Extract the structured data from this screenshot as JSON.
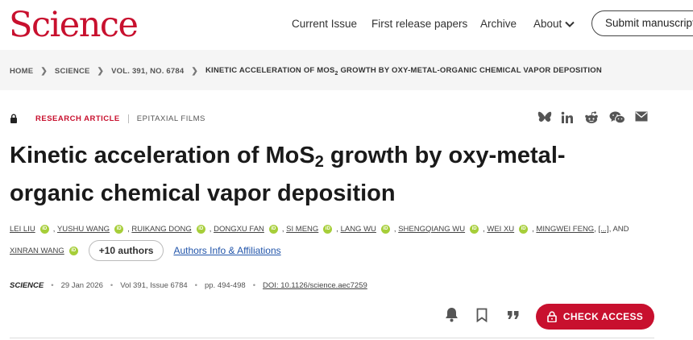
{
  "header": {
    "logo": "Science",
    "nav": [
      {
        "label": "Current Issue"
      },
      {
        "label": "First release papers"
      },
      {
        "label": "Archive"
      },
      {
        "label": "About"
      }
    ],
    "submit_label": "Submit manuscript"
  },
  "breadcrumb": {
    "items": [
      "HOME",
      "SCIENCE",
      "VOL. 391, NO. 6784"
    ],
    "current_pre": "KINETIC ACCELERATION OF MOS",
    "current_sub": "2",
    "current_post": " GROWTH BY OXY-METAL-ORGANIC CHEMICAL VAPOR DEPOSITION"
  },
  "article": {
    "kicker": "RESEARCH ARTICLE",
    "subject": "EPITAXIAL FILMS",
    "title_pre": "Kinetic acceleration of MoS",
    "title_sub": "2",
    "title_post": " growth by oxy-metal-organic chemical vapor deposition",
    "authors_line1": [
      "LEI LIU",
      "YUSHU WANG",
      "RUIKANG DONG",
      "DONGXU FAN",
      "SI MENG",
      "LANG WU",
      "SHENGQIANG WU",
      "WEI XU",
      "MINGWEI FENG"
    ],
    "ellipsis": "[...]",
    "and": ", AND",
    "last_author": "XINRAN WANG",
    "more_authors": "+10 authors",
    "affiliations": "Authors Info & Affiliations",
    "orcid": "iD"
  },
  "pubinfo": {
    "journal": "SCIENCE",
    "date": "29 Jan 2026",
    "volume": "Vol 391, Issue 6784",
    "pages": "pp. 494-498",
    "doi": "DOI: 10.1126/science.aec7259"
  },
  "actions": {
    "check_access": "CHECK ACCESS"
  },
  "share_icons": [
    "bluesky-icon",
    "linkedin-icon",
    "reddit-icon",
    "wechat-icon",
    "email-icon"
  ],
  "colors": {
    "brand": "#c8102e",
    "orcid": "#a6ce39",
    "link": "#2255aa"
  }
}
